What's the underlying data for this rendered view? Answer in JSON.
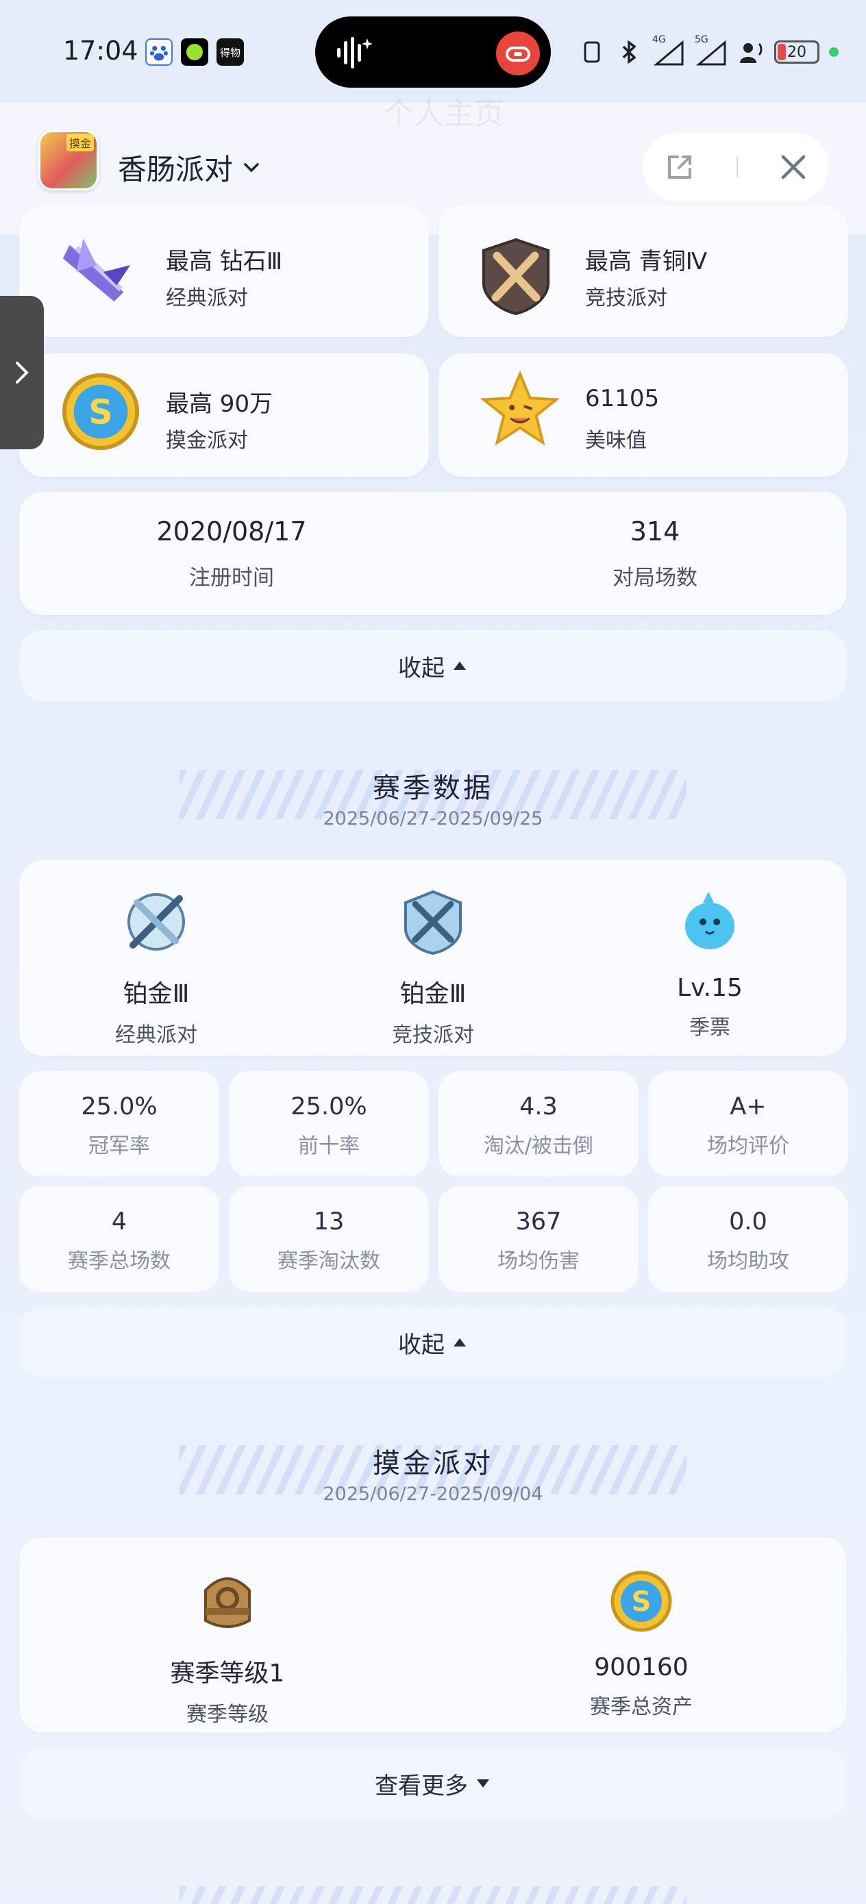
{
  "status_bar": {
    "time": "17:04",
    "battery": "20",
    "signal_labels": [
      "4G",
      "5G"
    ],
    "notification_app_label": "得物"
  },
  "app_header": {
    "app_name": "香肠派对",
    "logo_text": "摸金",
    "faded_title": "个人主页"
  },
  "profile_stats": [
    {
      "main": "最高 钻石Ⅲ",
      "sub": "经典派对",
      "icon": "diamond-rank-icon"
    },
    {
      "main": "最高 青铜Ⅳ",
      "sub": "竞技派对",
      "icon": "bronze-rank-icon"
    },
    {
      "main": "最高 90万",
      "sub": "摸金派对",
      "icon": "gold-coin-icon"
    },
    {
      "main": "61105",
      "sub": "美味值",
      "icon": "star-face-icon"
    }
  ],
  "summary": {
    "register_date": "2020/08/17",
    "register_label": "注册时间",
    "matches": "314",
    "matches_label": "对局场数"
  },
  "collapse_label_1": "收起",
  "season": {
    "title": "赛季数据",
    "date_range": "2025/06/27-2025/09/25",
    "tiers": [
      {
        "value": "铂金Ⅲ",
        "label": "经典派对",
        "icon": "platinum-classic-icon"
      },
      {
        "value": "铂金Ⅲ",
        "label": "竞技派对",
        "icon": "platinum-competitive-icon"
      },
      {
        "value": "Lv.15",
        "label": "季票",
        "icon": "season-pass-bird-icon"
      }
    ],
    "stats": [
      {
        "value": "25.0%",
        "label": "冠军率"
      },
      {
        "value": "25.0%",
        "label": "前十率"
      },
      {
        "value": "4.3",
        "label": "淘汰/被击倒"
      },
      {
        "value": "A+",
        "label": "场均评价"
      },
      {
        "value": "4",
        "label": "赛季总场数"
      },
      {
        "value": "13",
        "label": "赛季淘汰数"
      },
      {
        "value": "367",
        "label": "场均伤害"
      },
      {
        "value": "0.0",
        "label": "场均助攻"
      }
    ],
    "collapse_label": "收起"
  },
  "gold_party": {
    "title": "摸金派对",
    "date_range": "2025/06/27-2025/09/04",
    "items": [
      {
        "value": "赛季等级1",
        "label": "赛季等级",
        "icon": "season-level-badge-icon"
      },
      {
        "value": "900160",
        "label": "赛季总资产",
        "icon": "gold-coin-icon"
      }
    ],
    "more_label": "查看更多"
  },
  "colors": {
    "background": "#e6ecfa",
    "card": "#f8faff",
    "text_primary": "#1f2236",
    "text_secondary": "#8a8fa3",
    "record_red": "#e8463a"
  }
}
